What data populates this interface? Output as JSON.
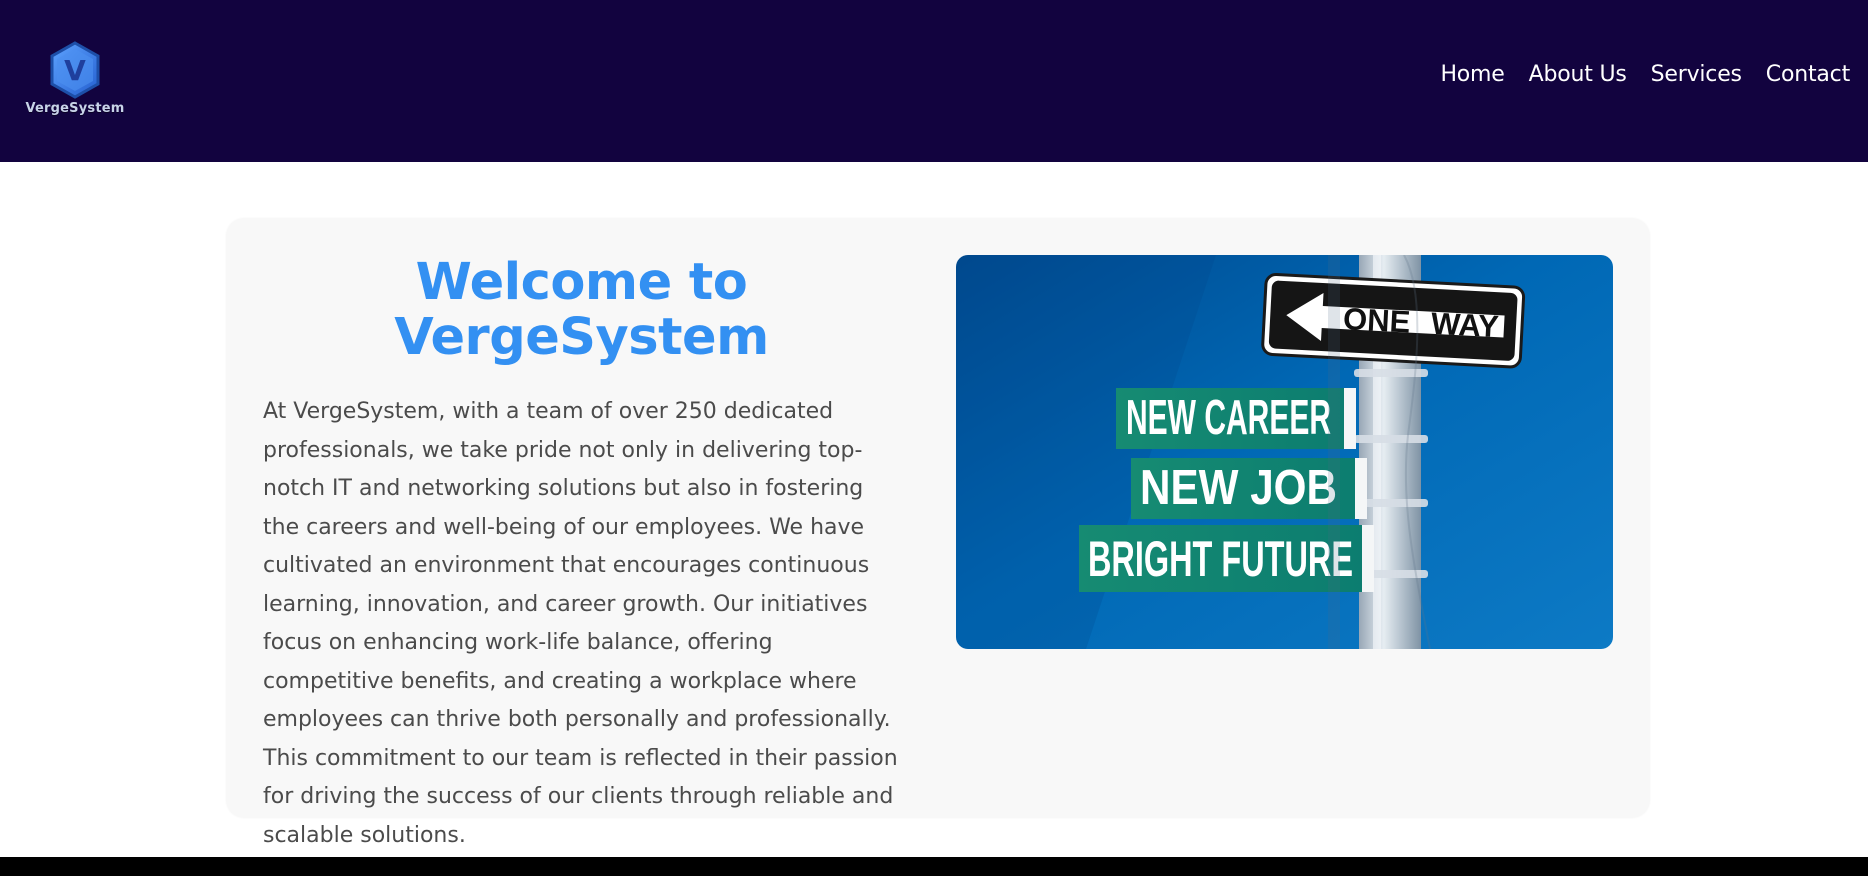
{
  "brand": {
    "logo_letter": "V",
    "name": "VergeSystem"
  },
  "nav": {
    "items": [
      {
        "label": "Home"
      },
      {
        "label": "About Us"
      },
      {
        "label": "Services"
      },
      {
        "label": "Contact"
      }
    ]
  },
  "hero": {
    "title": "Welcome to VergeSystem",
    "body": "At VergeSystem, with a team of over 250 dedicated professionals, we take pride not only in delivering top-notch IT and networking solutions but also in fostering the careers and well-being of our employees. We have cultivated an environment that encourages continuous learning, innovation, and career growth. Our initiatives focus on enhancing work-life balance, offering competitive benefits, and creating a workplace where employees can thrive both personally and professionally. This commitment to our team is reflected in their passion for driving the success of our clients through reliable and scalable solutions.",
    "image_signs": {
      "top": "ONE WAY",
      "middle_1": "NEW CAREER",
      "middle_2": "NEW JOB",
      "bottom": "BRIGHT FUTURE"
    }
  },
  "colors": {
    "header_bg": "#12033f",
    "title": "#3390f2",
    "card_bg": "#f8f8f8",
    "footer_bg": "#000000"
  }
}
